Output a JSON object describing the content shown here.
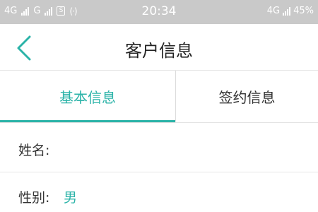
{
  "status_bar": {
    "network1": "4G",
    "network2": "G",
    "sim_label": "S",
    "radio": "(·)",
    "time": "20:34",
    "right_network": "4G",
    "battery": "45%"
  },
  "header": {
    "title": "客户信息",
    "back_icon": "chevron-left-icon"
  },
  "tabs": [
    {
      "label": "基本信息",
      "active": true
    },
    {
      "label": "签约信息",
      "active": false
    }
  ],
  "fields": {
    "name_label": "姓名:",
    "name_value": "",
    "gender_label": "性别:",
    "gender_value": "男"
  },
  "colors": {
    "accent": "#2bb3a8",
    "status_bar_bg": "#c9c9c9"
  }
}
